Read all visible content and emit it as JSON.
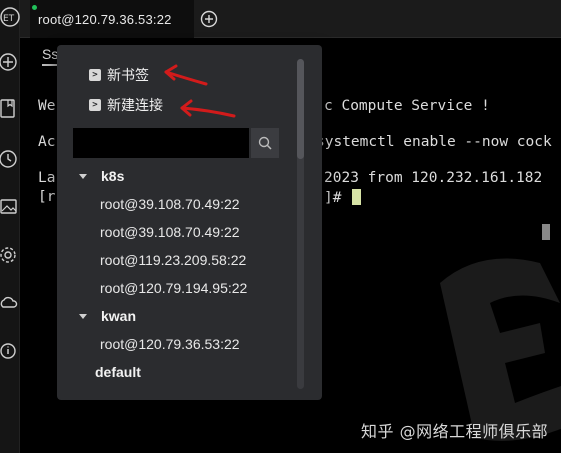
{
  "rail": {
    "icons": [
      "logo-icon",
      "add-icon",
      "bookmark-icon",
      "history-icon",
      "image-icon",
      "settings-icon",
      "cloud-sync-icon",
      "info-icon"
    ]
  },
  "tabbar": {
    "active_tab": "root@120.79.36.53:22",
    "status_color": "#21c05a"
  },
  "terminal": {
    "subtab_label": "Ss",
    "lines": [
      "We",
      "Ac",
      "La",
      "[r"
    ],
    "right_lines": [
      "c Compute Service !",
      "systemctl enable --now cock",
      "2023 from 120.232.161.182",
      "]# "
    ]
  },
  "menu": {
    "new_bookmark": "新书签",
    "new_connection": "新建连接",
    "search_placeholder": "",
    "groups": [
      {
        "name": "k8s",
        "hosts": [
          "root@39.108.70.49:22",
          "root@39.108.70.49:22",
          "root@119.23.209.58:22",
          "root@120.79.194.95:22"
        ]
      },
      {
        "name": "kwan",
        "hosts": [
          "root@120.79.36.53:22"
        ]
      }
    ],
    "default_group": "default"
  },
  "annotation_color": "#d21b1b",
  "watermark": "知乎 @网络工程师俱乐部"
}
